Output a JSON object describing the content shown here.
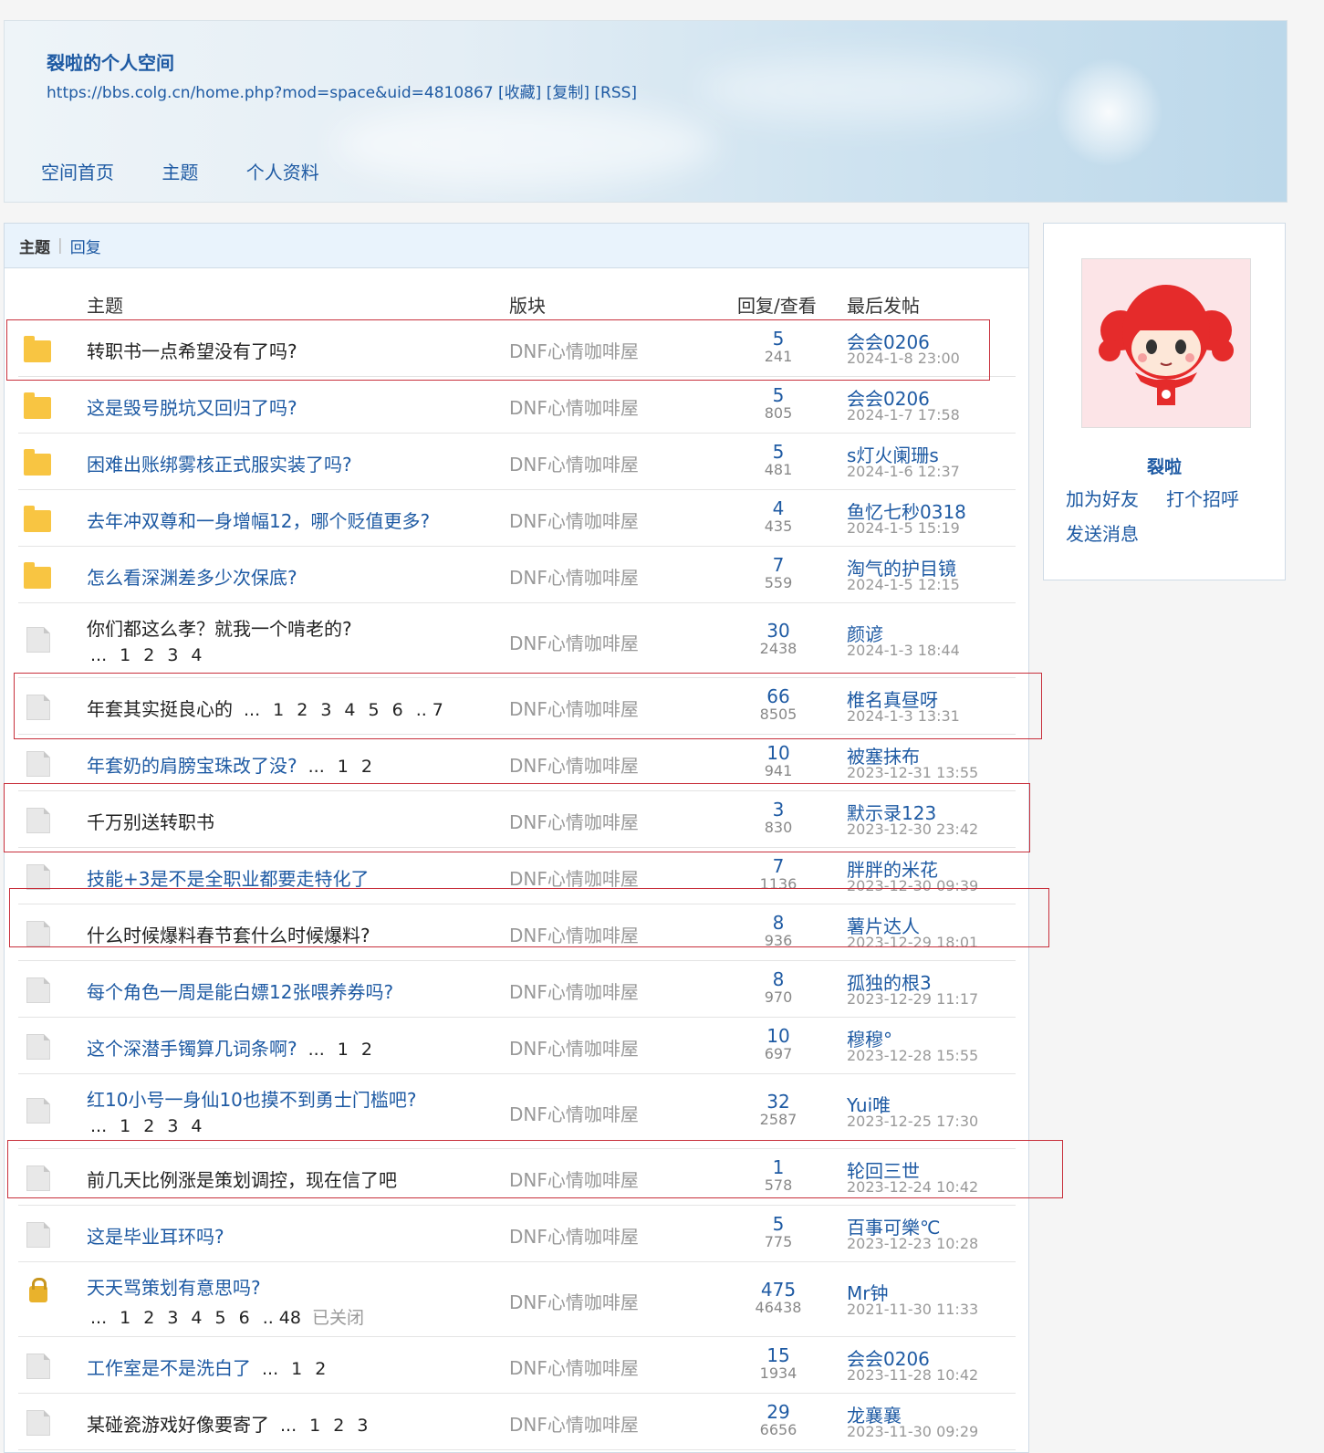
{
  "header": {
    "title": "裂啦的个人空间",
    "url": "https://bbs.colg.cn/home.php?mod=space&uid=4810867",
    "actions": [
      "[收藏]",
      "[复制]",
      "[RSS]"
    ],
    "nav": [
      "空间首页",
      "主题",
      "个人资料"
    ]
  },
  "tabs": {
    "active": "主题",
    "other": "回复"
  },
  "columns": {
    "subject": "主题",
    "forum": "版块",
    "stats": "回复/查看",
    "last": "最后发帖"
  },
  "threads": [
    {
      "icon": "folder-icon",
      "title": "转职书一点希望没有了吗?",
      "dark": true,
      "pages": [],
      "forum": "DNF心情咖啡屋",
      "replies": "5",
      "views": "241",
      "last_user": "会会0206",
      "last_time": "2024-1-8 23:00"
    },
    {
      "icon": "folder-icon",
      "title": "这是毁号脱坑又回归了吗?",
      "dark": false,
      "pages": [],
      "forum": "DNF心情咖啡屋",
      "replies": "5",
      "views": "805",
      "last_user": "会会0206",
      "last_time": "2024-1-7 17:58"
    },
    {
      "icon": "folder-icon",
      "title": "困难出账绑雾核正式服实装了吗?",
      "dark": false,
      "pages": [],
      "forum": "DNF心情咖啡屋",
      "replies": "5",
      "views": "481",
      "last_user": "s灯火阑珊s",
      "last_time": "2024-1-6 12:37"
    },
    {
      "icon": "folder-icon",
      "title": "去年冲双尊和一身增幅12，哪个贬值更多?",
      "dark": false,
      "pages": [],
      "forum": "DNF心情咖啡屋",
      "replies": "4",
      "views": "435",
      "last_user": "鱼忆七秒0318",
      "last_time": "2024-1-5 15:19"
    },
    {
      "icon": "folder-icon",
      "title": "怎么看深渊差多少次保底?",
      "dark": false,
      "pages": [],
      "forum": "DNF心情咖啡屋",
      "replies": "7",
      "views": "559",
      "last_user": "淘气的护目镜",
      "last_time": "2024-1-5 12:15"
    },
    {
      "icon": "document-icon",
      "title": "你们都这么孝？就我一个啃老的?",
      "dark": true,
      "pages_below": true,
      "pages": [
        "1",
        "2",
        "3",
        "4"
      ],
      "forum": "DNF心情咖啡屋",
      "replies": "30",
      "views": "2438",
      "last_user": "颜谚",
      "last_time": "2024-1-3 18:44"
    },
    {
      "icon": "document-icon",
      "title": "年套其实挺良心的",
      "dark": true,
      "pages": [
        "1",
        "2",
        "3",
        "4",
        "5",
        "6",
        ".. 7"
      ],
      "forum": "DNF心情咖啡屋",
      "replies": "66",
      "views": "8505",
      "last_user": "椎名真昼呀",
      "last_time": "2024-1-3 13:31"
    },
    {
      "icon": "document-icon",
      "title": "年套奶的肩膀宝珠改了没?",
      "dark": false,
      "pages": [
        "1",
        "2"
      ],
      "forum": "DNF心情咖啡屋",
      "replies": "10",
      "views": "941",
      "last_user": "被塞抹布",
      "last_time": "2023-12-31 13:55"
    },
    {
      "icon": "document-icon",
      "title": "千万别送转职书",
      "dark": true,
      "pages": [],
      "forum": "DNF心情咖啡屋",
      "replies": "3",
      "views": "830",
      "last_user": "默示录123",
      "last_time": "2023-12-30 23:42"
    },
    {
      "icon": "document-icon",
      "title": "技能+3是不是全职业都要走特化了",
      "dark": false,
      "pages": [],
      "forum": "DNF心情咖啡屋",
      "replies": "7",
      "views": "1136",
      "last_user": "胖胖的米花",
      "last_time": "2023-12-30 09:39"
    },
    {
      "icon": "document-icon",
      "title": "什么时候爆料春节套什么时候爆料?",
      "dark": true,
      "pages": [],
      "forum": "DNF心情咖啡屋",
      "replies": "8",
      "views": "936",
      "last_user": "薯片达人",
      "last_time": "2023-12-29 18:01"
    },
    {
      "icon": "document-icon",
      "title": "每个角色一周是能白嫖12张喂养券吗?",
      "dark": false,
      "pages": [],
      "forum": "DNF心情咖啡屋",
      "replies": "8",
      "views": "970",
      "last_user": "孤独的根3",
      "last_time": "2023-12-29 11:17"
    },
    {
      "icon": "document-icon",
      "title": "这个深潜手镯算几词条啊?",
      "dark": false,
      "pages": [
        "1",
        "2"
      ],
      "forum": "DNF心情咖啡屋",
      "replies": "10",
      "views": "697",
      "last_user": "穆穆°",
      "last_time": "2023-12-28 15:55"
    },
    {
      "icon": "document-icon",
      "title": "红10小号一身仙10也摸不到勇士门槛吧?",
      "dark": false,
      "pages_below": true,
      "pages": [
        "1",
        "2",
        "3",
        "4"
      ],
      "forum": "DNF心情咖啡屋",
      "replies": "32",
      "views": "2587",
      "last_user": "Yui唯",
      "last_time": "2023-12-25 17:30"
    },
    {
      "icon": "document-icon",
      "title": "前几天比例涨是策划调控，现在信了吧",
      "dark": true,
      "pages": [],
      "forum": "DNF心情咖啡屋",
      "replies": "1",
      "views": "578",
      "last_user": "轮回三世",
      "last_time": "2023-12-24 10:42"
    },
    {
      "icon": "document-icon",
      "title": "这是毕业耳环吗?",
      "dark": false,
      "pages": [],
      "forum": "DNF心情咖啡屋",
      "replies": "5",
      "views": "775",
      "last_user": "百事可樂℃",
      "last_time": "2023-12-23 10:28"
    },
    {
      "icon": "lock-icon",
      "title": "天天骂策划有意思吗?",
      "dark": false,
      "pages_below": true,
      "pages": [
        "1",
        "2",
        "3",
        "4",
        "5",
        "6",
        ".. 48"
      ],
      "closed": "已关闭",
      "forum": "DNF心情咖啡屋",
      "replies": "475",
      "views": "46438",
      "last_user": "Mr钟",
      "last_time": "2021-11-30 11:33"
    },
    {
      "icon": "document-icon",
      "title": "工作室是不是洗白了",
      "dark": false,
      "pages": [
        "1",
        "2"
      ],
      "forum": "DNF心情咖啡屋",
      "replies": "15",
      "views": "1934",
      "last_user": "会会0206",
      "last_time": "2023-11-28 10:42"
    },
    {
      "icon": "document-icon",
      "title": "某碰瓷游戏好像要寄了",
      "dark": true,
      "pages": [
        "1",
        "2",
        "3"
      ],
      "forum": "DNF心情咖啡屋",
      "replies": "29",
      "views": "6656",
      "last_user": "龙襄襄",
      "last_time": "2023-11-30 09:29"
    }
  ],
  "profile": {
    "username": "裂啦",
    "add_friend": "加为好友",
    "greet": "打个招呼",
    "message": "发送消息"
  },
  "ellipsis": "..."
}
